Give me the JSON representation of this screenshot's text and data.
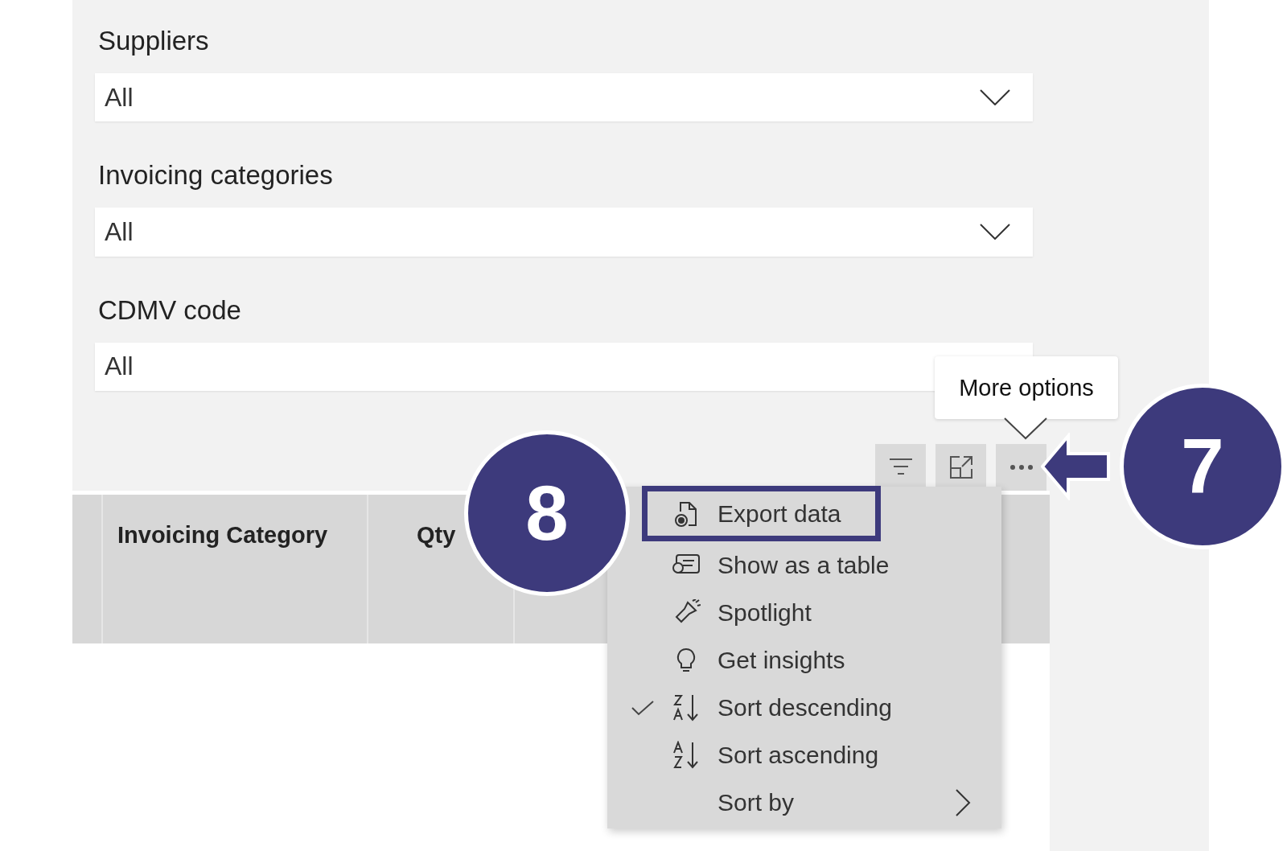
{
  "slicers": [
    {
      "label": "Suppliers",
      "value": "All",
      "dropdown_arrow": true
    },
    {
      "label": "Invoicing categories",
      "value": "All",
      "dropdown_arrow": true
    },
    {
      "label": "CDMV code",
      "value": "All",
      "dropdown_arrow": false
    }
  ],
  "tooltip": {
    "text": "More options"
  },
  "table": {
    "columns": [
      "Invoicing Category",
      "Qty"
    ]
  },
  "menu": {
    "items": [
      {
        "label": "Export data",
        "checked": false,
        "highlighted": true,
        "submenu": false
      },
      {
        "label": "Show as a table",
        "checked": false,
        "highlighted": false,
        "submenu": false
      },
      {
        "label": "Spotlight",
        "checked": false,
        "highlighted": false,
        "submenu": false
      },
      {
        "label": "Get insights",
        "checked": false,
        "highlighted": false,
        "submenu": false
      },
      {
        "label": "Sort descending",
        "checked": true,
        "highlighted": false,
        "submenu": false
      },
      {
        "label": "Sort ascending",
        "checked": false,
        "highlighted": false,
        "submenu": false
      },
      {
        "label": "Sort by",
        "checked": false,
        "highlighted": false,
        "submenu": true
      }
    ]
  },
  "callouts": [
    {
      "number": "8"
    },
    {
      "number": "7"
    }
  ]
}
